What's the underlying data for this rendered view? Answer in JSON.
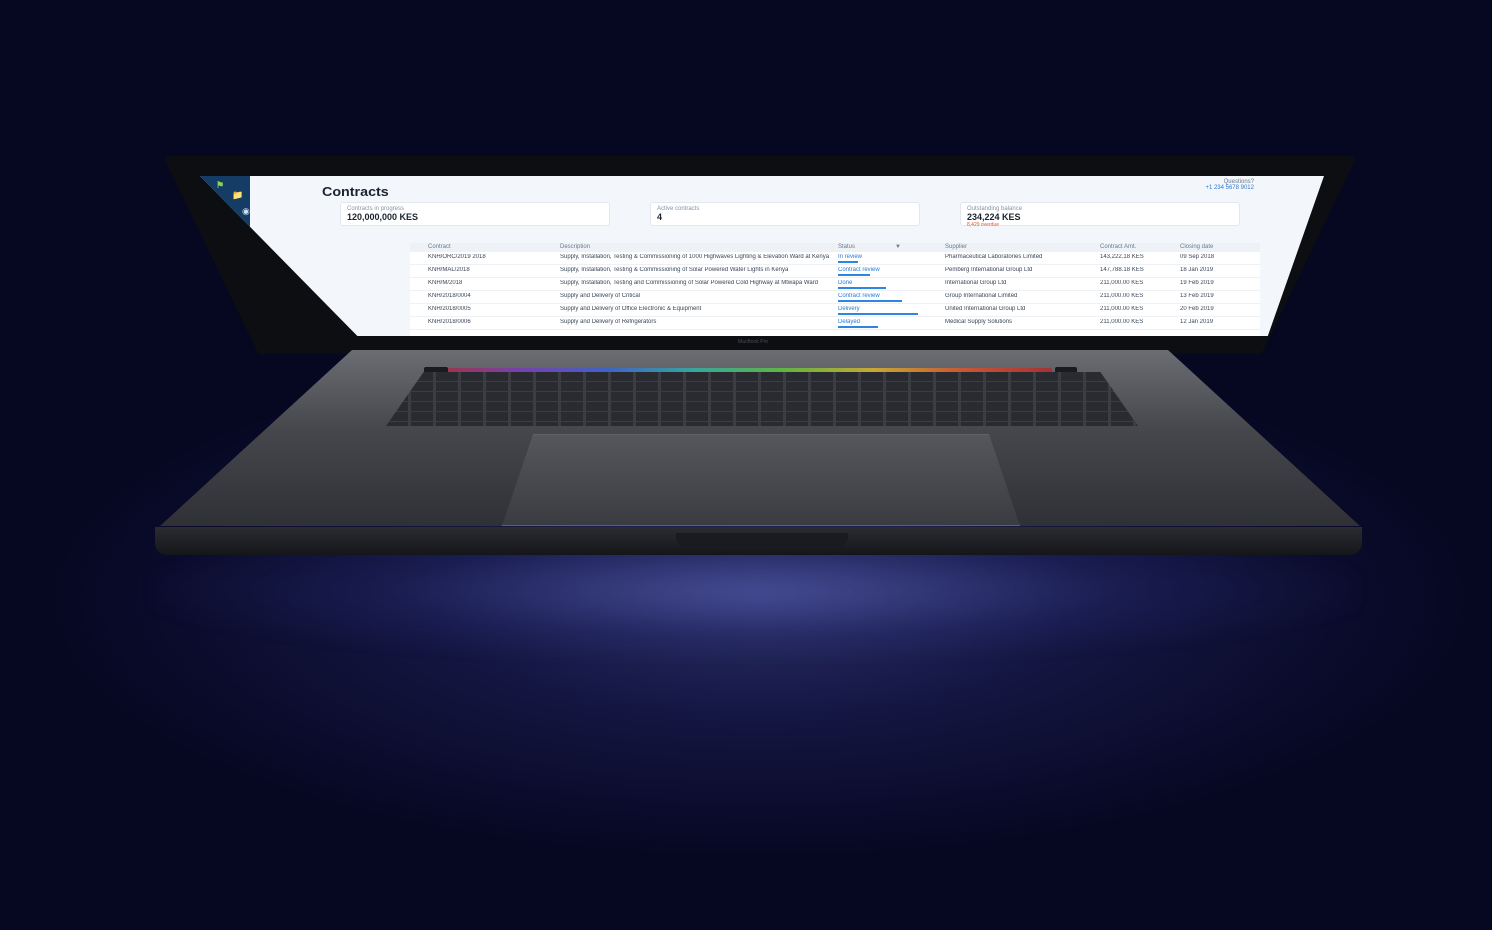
{
  "app": {
    "page_title": "Contracts",
    "help_label": "Questions?",
    "help_phone": "+1 234 5678 9012"
  },
  "stats": [
    {
      "label": "Contracts in progress",
      "value": "120,000,000 KES",
      "sub": ""
    },
    {
      "label": "Active contracts",
      "value": "4",
      "sub": ""
    },
    {
      "label": "Outstanding balance",
      "value": "234,224 KES",
      "sub": "8,429 overdue"
    }
  ],
  "table": {
    "headers": [
      "Contract",
      "Description",
      "Status",
      "Supplier",
      "Contract Amt.",
      "Closing date"
    ],
    "rows": [
      {
        "contract": "KNH/ORC/2019 2018",
        "description": "Supply, Installation, Testing & Commissioning of 1000 Highwaves Lighting & Elevation Ward at Kenya",
        "status": "In review",
        "progress": 0.25,
        "supplier": "Pharmaceutical Laboratories Limited",
        "amount": "143,222.18 KES",
        "closing": "09 Sep 2018"
      },
      {
        "contract": "KNH/MAL/2018",
        "description": "Supply, Installation, Testing & Commissioning of Solar Powered Water Lights in Kenya",
        "status": "Contract review",
        "progress": 0.4,
        "supplier": "Pemberg International Group Ltd",
        "amount": "147,788.18 KES",
        "closing": "18 Jan 2019"
      },
      {
        "contract": "KNH/M/2018",
        "description": "Supply, Installation, Testing and Commissioning of Solar Powered Cold Highway at Mtwapa Ward",
        "status": "Done",
        "progress": 0.6,
        "supplier": "International Group Ltd",
        "amount": "211,000.00 KES",
        "closing": "19 Feb 2019"
      },
      {
        "contract": "KNH/2018/0004",
        "description": "Supply and Delivery of Critical",
        "status": "Contract review",
        "progress": 0.8,
        "supplier": "Group International Limited",
        "amount": "211,000.00 KES",
        "closing": "13 Feb 2019"
      },
      {
        "contract": "KNH/2018/0005",
        "description": "Supply and Delivery of Office Electronic & Equipment",
        "status": "Delivery",
        "progress": 1.0,
        "supplier": "United International Group Ltd",
        "amount": "211,000.00 KES",
        "closing": "20 Feb 2019"
      },
      {
        "contract": "KNH/2018/0006",
        "description": "Supply and Delivery of Refrigerators",
        "status": "Delayed",
        "progress": 0.5,
        "supplier": "Medical Supply Solutions",
        "amount": "211,000.00 KES",
        "closing": "12 Jan 2019"
      }
    ]
  },
  "sidebar": {
    "icons": [
      "logo-icon",
      "folder-icon",
      "eye-icon"
    ],
    "dot_colors": [
      "#e0552d",
      "#3ac28a"
    ]
  },
  "laptop": {
    "bezel_label": "MacBook Pro"
  },
  "colors": {
    "accent": "#2a7bd6",
    "sidebar": "#143c64",
    "warning": "#e0552d"
  }
}
